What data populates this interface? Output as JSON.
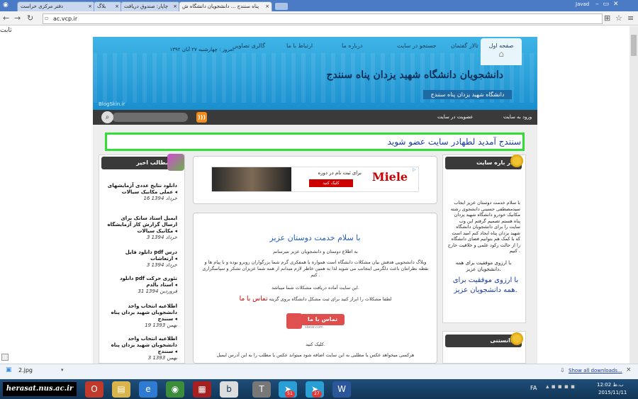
{
  "browser": {
    "tabs": [
      {
        "label": "دفتر مرکزی حراست"
      },
      {
        "label": "بلاگ"
      },
      {
        "label": "چاپار: صندوق دریافت"
      },
      {
        "label": "پناه سنندج ... دانشجویان دانشگاه ش"
      }
    ],
    "user": "Javad",
    "url": "ac.vcp.ir",
    "side_text": "ثابت"
  },
  "site": {
    "nav": {
      "home": "صفحه اول",
      "forum": "تالار گفتمان",
      "search": "جستجو در سایت",
      "about": "درباره ما",
      "contact": "ارتباط با ما",
      "gallery": "گالری تصاویر"
    },
    "date": "امروز : چهارشنبه ۲۷ آبان ۱۳۹۲",
    "title": "دانشجویان دانشگاه شهید یزدان پناه سنندج",
    "subtitle": "دانشگاه شهید یزدان پناه سنندج",
    "watermark": "BlogSkin.ir",
    "login": "ورود به سایت",
    "register": "عضویت در سایت",
    "banner": "سنندج آمدید لطهادر سایت عضو شوید"
  },
  "right_sidebar": {
    "about_title": "در باره سایت",
    "about_text": "با سلام خدمت دوستان عزیز ایجاب سیدمصطفی حسینی دانشجوی رشته مکانیک خودرو دانشگاه شهید یزدان پناه هستم تصمیم گرفتم این وب سایت را برای دانشجویان دانشگاه شهید یزدان پناه ایجاد کنم امید است که با کمک هم بتوانیم فضای دانشگاه را از حالت رکود علمی و خلاقیت خارج کنیم .",
    "wish_small": "با ارزوی موفقیت برای همه دانشجویان عزیز.",
    "wish_big": "با ارزوی موفقیت برای همه دانشجویان عزیز.",
    "second_title": "دانستنی"
  },
  "left_sidebar": {
    "title": "مطالب اخیر",
    "items": [
      {
        "title": "دانلود نتایج عددی آزمایشهای عملی مکانیک سیالات",
        "date": "16 خرداد 1394"
      },
      {
        "title": "ایمیل استاد ساتک برای ارسال گزارش کار آزمایشگاه مکانیک سیالات",
        "date": "3 خرداد 1394"
      },
      {
        "title": "دانلود فایل pdf درس ارتعاشات",
        "date": "3 خرداد 1394"
      },
      {
        "title": "دانلود pdf تئوری حرکت استاد بالدم",
        "date": "31 فروردین 1394"
      },
      {
        "title": "اطلاعیه انتخاب واحد دانشجویان شهید یزدان پناه سنندج",
        "date": "19 بهمن 1393"
      },
      {
        "title": "اطلاعیه انتخاب واحد دانشجویان شهید یزدان پناه سنندج",
        "date": "3 بهمن 1393"
      }
    ]
  },
  "ad": {
    "brand": "Miele",
    "text": "برای ثبت نام در دوره",
    "button": "کلیک کنید"
  },
  "post": {
    "title": "با سلام خدمت دوستان عزیز",
    "p1": "به اطلاع دوستان و دانشجویان عزیز میرسانم",
    "p2": "وبلاگ دانشجویی هدفش بیان مشکلات دانشگاه است همواره با همفکری گرم شما بزرگواران روبرو بوده و با پیام ها و نقطه نظراتتان باعث دلگرمی اینجانب می شوید لذا به همین خاطر لازم میدانم از همه شما عزیزان تشکر و سپاسگزاری کنم .",
    "p3": "این سایت آماده دریافت مشکلات شما میباشد.",
    "p4": "لطفا مشکلات را ابراز کنید برای ثبت مشکل دانشگاه بروی گزینه",
    "contact_link": "تماس با ما",
    "contact_button": "تماس با ما",
    "contact_sub": "sbear.com",
    "p5": "کلیک کنید.",
    "p6": "هرکسی میخواهد عکس یا مطلبی به این سایت اضافه شود میتواند عکس یا مطلب را به این آدرس ایمیل"
  },
  "download_bar": {
    "file": "2.jpg",
    "show_all": "Show all downloads..."
  },
  "taskbar": {
    "watermark": "herasat.nus.ac.ir",
    "lang": "FA",
    "time": "12:02 ب.ظ",
    "date": "2015/11/11",
    "badge1": "51",
    "badge2": "27"
  }
}
